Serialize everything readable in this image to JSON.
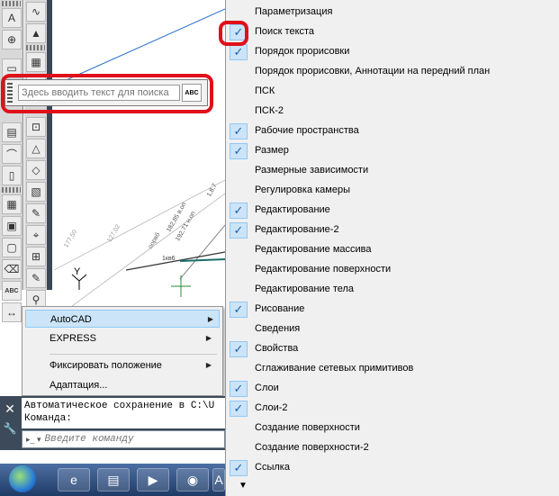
{
  "search_bar": {
    "placeholder": "Здесь вводить текст для поиска",
    "button_glyph": "ABC"
  },
  "submenu": {
    "items": [
      {
        "label": "AutoCAD",
        "submenu": true,
        "highlighted": true
      },
      {
        "label": "EXPRESS",
        "submenu": true
      },
      {
        "label": "Фиксировать положение",
        "submenu": true
      },
      {
        "label": "Адаптация...",
        "submenu": false
      }
    ]
  },
  "command_line": {
    "history": [
      "Автоматическое сохранение в C:\\U",
      "Команда:"
    ],
    "placeholder": "Введите команду",
    "close_glyph": "✕",
    "settings_glyph": "🔧"
  },
  "drawing_labels": [
    "1кв6",
    "оорвб",
    "177,50",
    "127,02",
    "182,85 в.оп",
    "192,71 н.оп",
    "1,8,7",
    "Y"
  ],
  "menu": {
    "items": [
      {
        "label": "Параметризация",
        "checked": false
      },
      {
        "label": "Поиск текста",
        "checked": true
      },
      {
        "label": "Порядок прорисовки",
        "checked": true
      },
      {
        "label": "Порядок прорисовки, Аннотации на передний план",
        "checked": false
      },
      {
        "label": "ПСК",
        "checked": false
      },
      {
        "label": "ПСК-2",
        "checked": false
      },
      {
        "label": "Рабочие пространства",
        "checked": true
      },
      {
        "label": "Размер",
        "checked": true
      },
      {
        "label": "Размерные зависимости",
        "checked": false
      },
      {
        "label": "Регулировка камеры",
        "checked": false
      },
      {
        "label": "Редактирование",
        "checked": true
      },
      {
        "label": "Редактирование-2",
        "checked": true
      },
      {
        "label": "Редактирование массива",
        "checked": false
      },
      {
        "label": "Редактирование поверхности",
        "checked": false
      },
      {
        "label": "Редактирование тела",
        "checked": false
      },
      {
        "label": "Рисование",
        "checked": true
      },
      {
        "label": "Сведения",
        "checked": false
      },
      {
        "label": "Свойства",
        "checked": true
      },
      {
        "label": "Сглаживание сетевых примитивов",
        "checked": false
      },
      {
        "label": "Слои",
        "checked": true
      },
      {
        "label": "Слои-2",
        "checked": true
      },
      {
        "label": "Создание поверхности",
        "checked": false
      },
      {
        "label": "Создание поверхности-2",
        "checked": false
      },
      {
        "label": "Ссылка",
        "checked": true
      }
    ],
    "check_glyph": "✓",
    "scroll_glyph": "▼"
  },
  "toolbar_col1": [
    "A",
    "⊕",
    "▭",
    "▤",
    "⌒",
    "▯",
    "▦",
    "▣",
    "▢",
    "⌫",
    "ABC",
    "↔"
  ],
  "toolbar_col2": [
    "∿",
    "▲",
    "▦",
    "▥",
    "⊡",
    "△",
    "◇",
    "▧",
    "✎",
    "⌖",
    "⊞",
    "✎",
    "⚲",
    "⌗",
    "⚓"
  ],
  "colors": {
    "highlight_ring": "#e0101a",
    "check_bg": "#cce4f7",
    "dark_panel": "#3d4a59"
  }
}
